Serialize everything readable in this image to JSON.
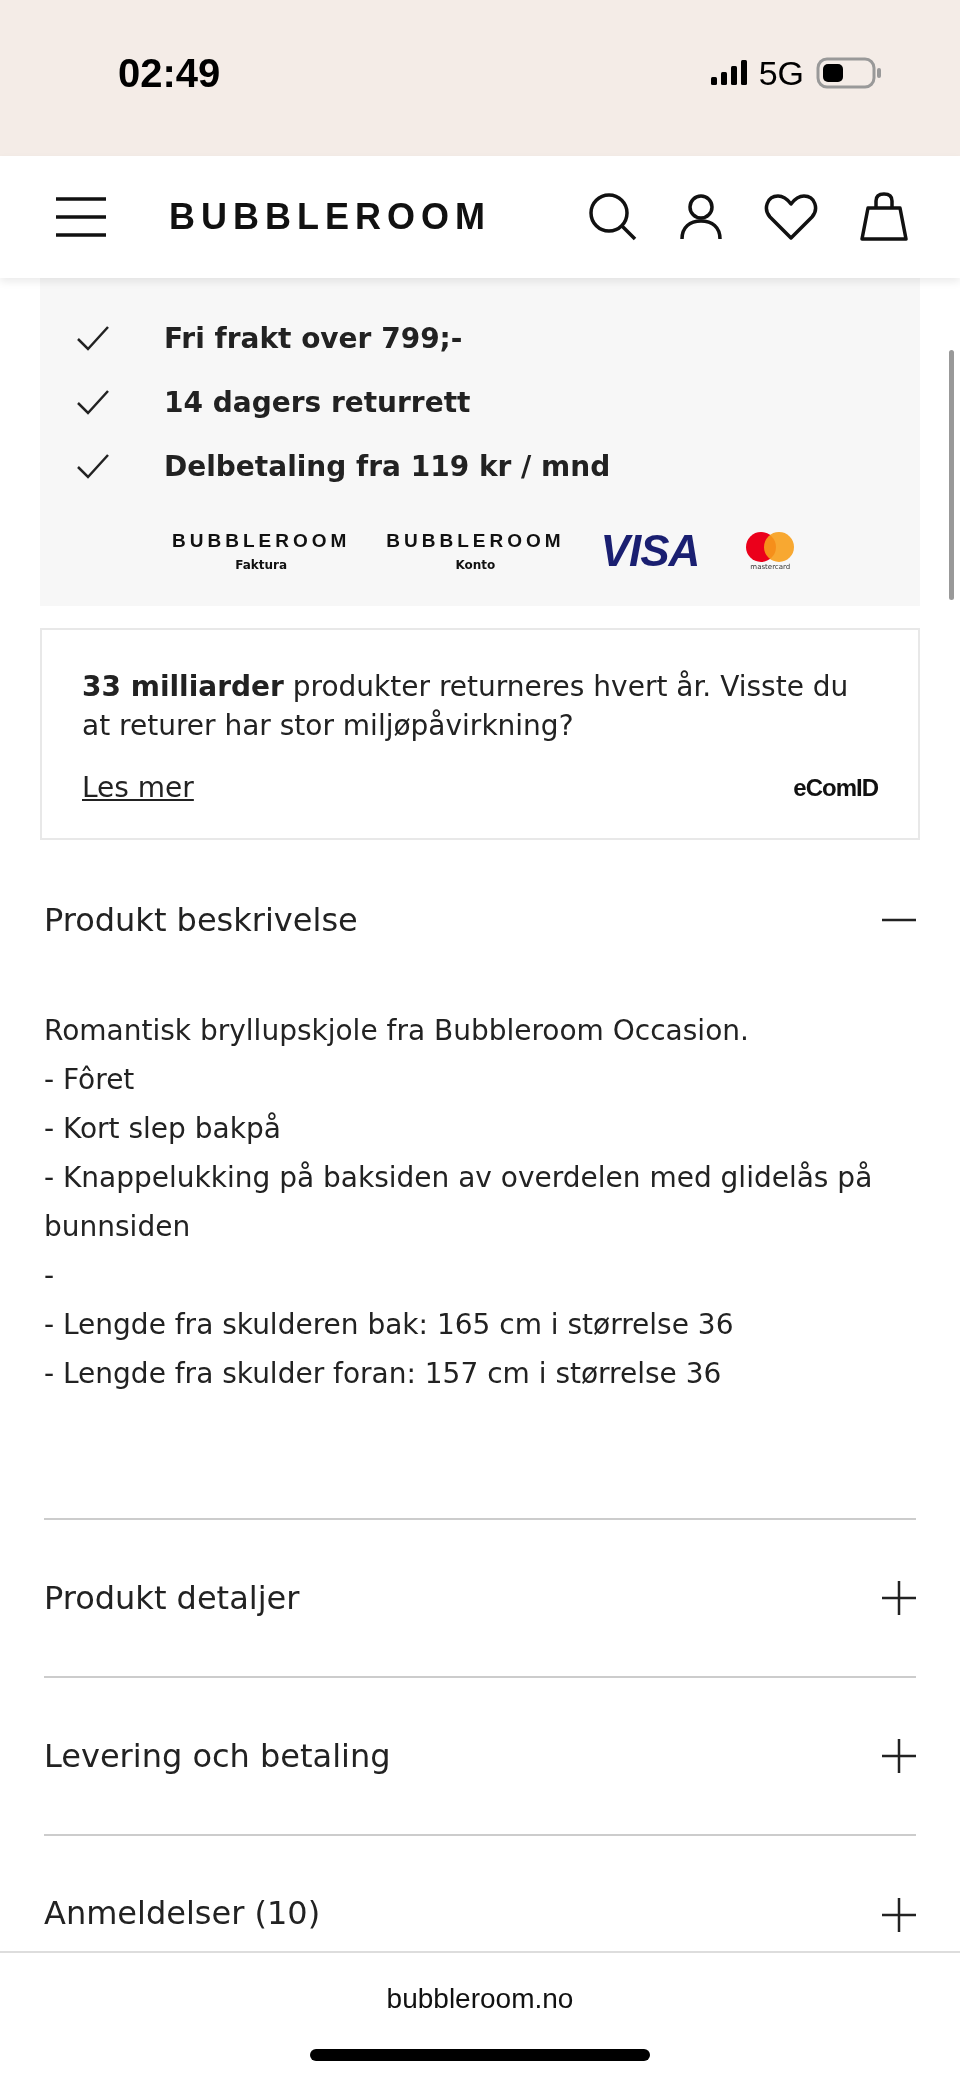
{
  "status_bar": {
    "time": "02:49",
    "network": "5G"
  },
  "header": {
    "logo": "BUBBLEROOM"
  },
  "benefits": [
    {
      "text": "Fri frakt over 799;-"
    },
    {
      "text": "14 dagers returrett"
    },
    {
      "text": "Delbetaling fra 119 kr / mnd"
    }
  ],
  "payment_methods": [
    {
      "kind": "brand",
      "name": "BUBBLEROOM",
      "caption": "Faktura"
    },
    {
      "kind": "brand",
      "name": "BUBBLEROOM",
      "caption": "Konto"
    },
    {
      "kind": "visa",
      "name": "VISA"
    },
    {
      "kind": "mastercard",
      "name": "mastercard"
    }
  ],
  "eco_notice": {
    "text": "**33 milliarder** produkter returneres hvert år. Visste du at returer har stor miljøpåvirkning?",
    "link": "Les mer",
    "provider": "eComID"
  },
  "accordions": [
    {
      "title": "Produkt beskrivelse",
      "expanded": true,
      "lines": [
        "Romantisk bryllupskjole fra Bubbleroom Occasion.",
        "- Fôret",
        "- Kort slep bakpå",
        "- Knappelukking på baksiden av overdelen med glidelås på bunnsiden",
        "-",
        "- Lengde fra skulderen bak: 165 cm i størrelse 36",
        "- Lengde fra skulder foran: 157 cm i størrelse 36"
      ]
    },
    {
      "title": "Produkt detaljer",
      "expanded": false
    },
    {
      "title": "Levering och betaling",
      "expanded": false
    },
    {
      "title": "Anmeldelser (10)",
      "expanded": false
    }
  ],
  "browser": {
    "url": "bubbleroom.no"
  }
}
